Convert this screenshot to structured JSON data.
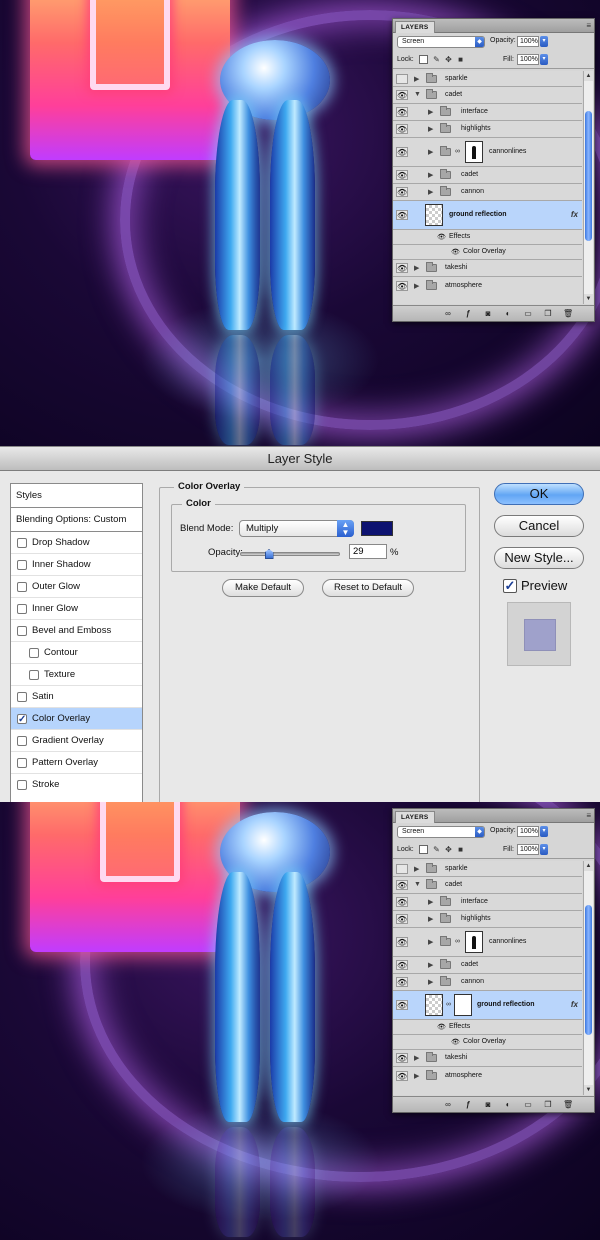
{
  "layers_panel": {
    "tab": "LAYERS",
    "blend_mode": "Screen",
    "opacity_label": "Opacity:",
    "opacity_value": "100%",
    "lock_label": "Lock:",
    "fill_label": "Fill:",
    "fill_value": "100%",
    "layers": {
      "sparkle": "sparkle",
      "cadet": "cadet",
      "interface": "interface",
      "highlights": "highlights",
      "cannonlines": "cannonlines",
      "cadet_sub": "cadet",
      "cannon": "cannon",
      "ground_reflection": "ground reflection",
      "effects": "Effects",
      "color_overlay": "Color Overlay",
      "takeshi": "takeshi",
      "atmosphere": "atmosphere"
    },
    "fx_badge": "fx"
  },
  "dialog": {
    "title": "Layer Style",
    "styles_header": "Styles",
    "blending_options": "Blending Options: Custom",
    "style_items": {
      "drop_shadow": "Drop Shadow",
      "inner_shadow": "Inner Shadow",
      "outer_glow": "Outer Glow",
      "inner_glow": "Inner Glow",
      "bevel_emboss": "Bevel and Emboss",
      "contour": "Contour",
      "texture": "Texture",
      "satin": "Satin",
      "color_overlay": "Color Overlay",
      "gradient_overlay": "Gradient Overlay",
      "pattern_overlay": "Pattern Overlay",
      "stroke": "Stroke"
    },
    "section_title": "Color Overlay",
    "group_title": "Color",
    "blend_mode_label": "Blend Mode:",
    "blend_mode_value": "Multiply",
    "overlay_color": "#0d1270",
    "opacity_label": "Opacity:",
    "opacity_value": "29",
    "opacity_fraction": 0.29,
    "percent_sign": "%",
    "make_default": "Make Default",
    "reset_default": "Reset to Default",
    "ok": "OK",
    "cancel": "Cancel",
    "new_style": "New Style...",
    "preview_label": "Preview",
    "check_mark": "✓"
  },
  "icons": {
    "eye": "👁",
    "triangle_right": "▶",
    "triangle_down": "▼",
    "chain": "∞",
    "menu": "≡"
  }
}
